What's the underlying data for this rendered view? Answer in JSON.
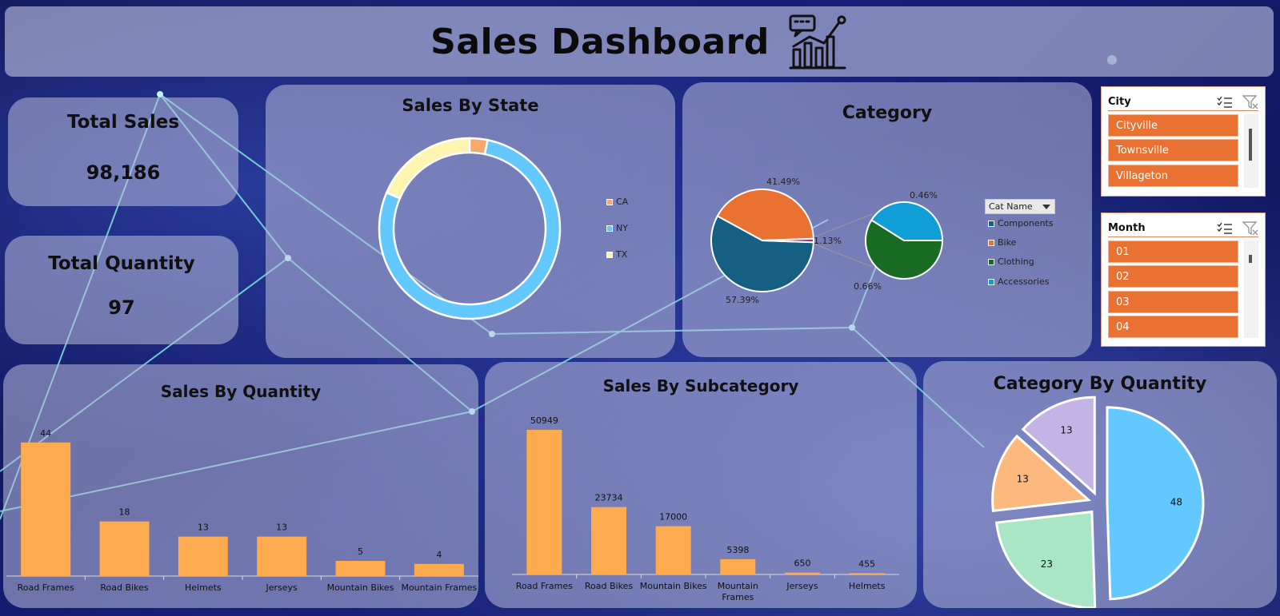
{
  "dashboard": {
    "title": "Sales Dashboard",
    "header_icon": "analytics-chart-icon"
  },
  "kpis": {
    "total_sales": {
      "label": "Total Sales",
      "value": "98,186"
    },
    "total_quantity": {
      "label": "Total Quantity",
      "value": "97"
    }
  },
  "colors": {
    "bar": "#fdab4e",
    "slicer_item": "#e97132",
    "panel": "rgba(185,190,220,0.55)"
  },
  "slicers": {
    "city": {
      "title": "City",
      "items": [
        "Cityville",
        "Townsville",
        "Villageton"
      ],
      "icons": [
        "multi-select-icon",
        "clear-filter-icon"
      ]
    },
    "month": {
      "title": "Month",
      "items": [
        "01",
        "02",
        "03",
        "04"
      ],
      "icons": [
        "multi-select-icon",
        "clear-filter-icon"
      ]
    }
  },
  "category_filter": {
    "label": "Cat Name"
  },
  "chart_data": [
    {
      "id": "sales_by_state",
      "type": "pie",
      "subtype": "donut",
      "title": "Sales By State",
      "categories": [
        "CA",
        "NY",
        "TX"
      ],
      "values": [
        3.2,
        78.3,
        18.5
      ],
      "colors": [
        "#f8a86a",
        "#63c8ff",
        "#fff4b0"
      ],
      "legend": "right"
    },
    {
      "id": "category",
      "type": "pie",
      "subtype": "pie-of-pie",
      "title": "Category",
      "legend_title": "Cat Name",
      "categories": [
        "Components",
        "Bike",
        "Clothing",
        "Accessories"
      ],
      "colors": [
        "#156082",
        "#e97132",
        "#196b24",
        "#0f9ed5"
      ],
      "main_pie": [
        {
          "label": "57.39%",
          "value": 57.39,
          "color": "#156082"
        },
        {
          "label": "41.49%",
          "value": 41.49,
          "color": "#e97132"
        },
        {
          "label": "1.13%",
          "value": 1.13,
          "color": "#a02b93"
        }
      ],
      "secondary_pie": [
        {
          "label": "0.66%",
          "value": 0.66,
          "color": "#196b24"
        },
        {
          "label": "0.46%",
          "value": 0.46,
          "color": "#0f9ed5"
        }
      ],
      "legend": "right"
    },
    {
      "id": "sales_by_quantity",
      "type": "bar",
      "title": "Sales By Quantity",
      "categories": [
        "Road Frames",
        "Road Bikes",
        "Helmets",
        "Jerseys",
        "Mountain Bikes",
        "Mountain Frames"
      ],
      "values": [
        44,
        18,
        13,
        13,
        5,
        4
      ],
      "ylim": [
        0,
        50
      ]
    },
    {
      "id": "sales_by_subcategory",
      "type": "bar",
      "title": "Sales By Subcategory",
      "categories": [
        "Road Frames",
        "Road Bikes",
        "Mountain Bikes",
        "Mountain Frames",
        "Jerseys",
        "Helmets"
      ],
      "values": [
        50949,
        23734,
        17000,
        5398,
        650,
        455
      ],
      "ylim": [
        0,
        56000
      ]
    },
    {
      "id": "category_by_quantity",
      "type": "pie",
      "subtype": "exploded",
      "title": "Category By Quantity",
      "values": [
        48,
        23,
        13,
        13
      ],
      "colors": [
        "#63c8ff",
        "#a8e6c6",
        "#fdb97d",
        "#c4b4e6"
      ]
    }
  ]
}
